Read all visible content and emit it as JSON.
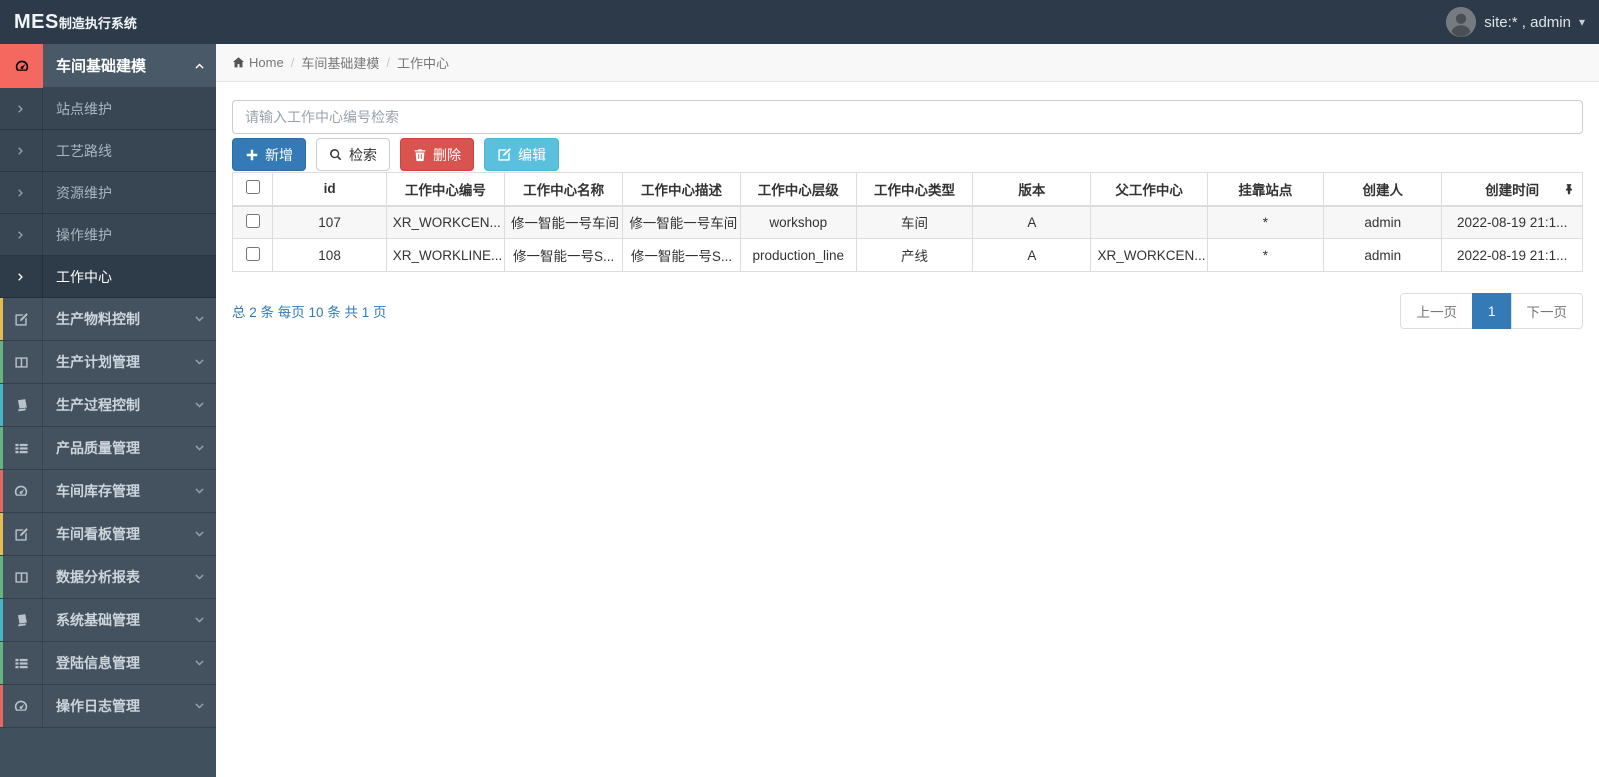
{
  "topbar": {
    "brand_bold": "MES",
    "brand_rest": "制造执行系统",
    "user_label": "site:* , admin",
    "user_caret": "▾"
  },
  "sidebar": {
    "header": {
      "label": "车间基础建模",
      "icon": "gauge",
      "icon_bg": "#f4685f"
    },
    "sub_items": [
      {
        "label": "站点维护",
        "active": false
      },
      {
        "label": "工艺路线",
        "active": false
      },
      {
        "label": "资源维护",
        "active": false
      },
      {
        "label": "操作维护",
        "active": false
      },
      {
        "label": "工作中心",
        "active": true
      }
    ],
    "groups": [
      {
        "label": "生产物料控制",
        "icon": "pencil-square",
        "stripe": "#e3bd4f"
      },
      {
        "label": "生产计划管理",
        "icon": "columns",
        "stripe": "#62b57f"
      },
      {
        "label": "生产过程控制",
        "icon": "book",
        "stripe": "#45b6c0"
      },
      {
        "label": "产品质量管理",
        "icon": "th-list",
        "stripe": "#62b57f"
      },
      {
        "label": "车间库存管理",
        "icon": "gauge",
        "stripe": "#e06a62"
      },
      {
        "label": "车间看板管理",
        "icon": "pencil-square",
        "stripe": "#e3bd4f"
      },
      {
        "label": "数据分析报表",
        "icon": "columns",
        "stripe": "#62b57f"
      },
      {
        "label": "系统基础管理",
        "icon": "book",
        "stripe": "#45b6c0"
      },
      {
        "label": "登陆信息管理",
        "icon": "th-list",
        "stripe": "#62b57f"
      },
      {
        "label": "操作日志管理",
        "icon": "gauge",
        "stripe": "#e06a62"
      }
    ]
  },
  "breadcrumb": {
    "items": [
      "Home",
      "车间基础建模",
      "工作中心"
    ]
  },
  "toolbar": {
    "search_placeholder": "请输入工作中心编号检索",
    "buttons": [
      {
        "label": "新增",
        "icon": "plus",
        "style": "primary"
      },
      {
        "label": "检索",
        "icon": "search",
        "style": "default"
      },
      {
        "label": "删除",
        "icon": "trash",
        "style": "danger"
      },
      {
        "label": "编辑",
        "icon": "pencil-square",
        "style": "info"
      }
    ]
  },
  "table": {
    "columns": [
      "id",
      "工作中心编号",
      "工作中心名称",
      "工作中心描述",
      "工作中心层级",
      "工作中心类型",
      "版本",
      "父工作中心",
      "挂靠站点",
      "创建人",
      "创建时间"
    ],
    "rows": [
      [
        "107",
        "XR_WORKCEN...",
        "修一智能一号车间",
        "修一智能一号车间",
        "workshop",
        "车间",
        "A",
        "",
        "*",
        "admin",
        "2022-08-19 21:1..."
      ],
      [
        "108",
        "XR_WORKLINE...",
        "修一智能一号S...",
        "修一智能一号S...",
        "production_line",
        "产线",
        "A",
        "XR_WORKCEN...",
        "*",
        "admin",
        "2022-08-19 21:1..."
      ]
    ]
  },
  "pagination": {
    "summary": "总 2 条  每页 10 条  共 1 页",
    "prev": "上一页",
    "current": "1",
    "next": "下一页"
  },
  "colors": {
    "primary": "#337ab7",
    "danger": "#d9534f",
    "info": "#5bc0de",
    "topbar": "#2c3a49",
    "sidebar": "#41505d",
    "accent_red": "#f4685f"
  }
}
